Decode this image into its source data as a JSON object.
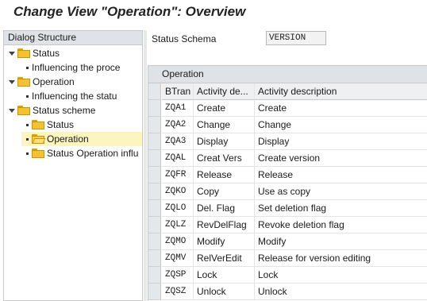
{
  "title": "Change View \"Operation\": Overview",
  "dialog_structure": {
    "header": "Dialog Structure",
    "items": [
      {
        "label": "Status",
        "level": 0,
        "type": "folder",
        "expanded": true,
        "selected": false
      },
      {
        "label": "Influencing the proce",
        "level": 1,
        "type": "item",
        "selected": false
      },
      {
        "label": "Operation",
        "level": 0,
        "type": "folder",
        "expanded": true,
        "selected": false
      },
      {
        "label": "Influencing the statu",
        "level": 1,
        "type": "item",
        "selected": false
      },
      {
        "label": "Status scheme",
        "level": 0,
        "type": "folder",
        "expanded": true,
        "selected": false
      },
      {
        "label": "Status",
        "level": 1,
        "type": "folder",
        "selected": false
      },
      {
        "label": "Operation",
        "level": 1,
        "type": "folder-open",
        "selected": true
      },
      {
        "label": "Status Operation influ",
        "level": 1,
        "type": "folder",
        "selected": false
      }
    ]
  },
  "status_schema": {
    "label": "Status Schema",
    "value": "VERSION"
  },
  "table": {
    "title": "Operation",
    "columns": [
      "BTran",
      "Activity de...",
      "Activity description"
    ],
    "rows": [
      [
        "ZQA1",
        "Create",
        "Create"
      ],
      [
        "ZQA2",
        "Change",
        "Change"
      ],
      [
        "ZQA3",
        "Display",
        "Display"
      ],
      [
        "ZQAL",
        "Creat Vers",
        "Create version"
      ],
      [
        "ZQFR",
        "Release",
        "Release"
      ],
      [
        "ZQKO",
        "Copy",
        "Use as copy"
      ],
      [
        "ZQLO",
        "Del. Flag",
        "Set deletion flag"
      ],
      [
        "ZQLZ",
        "RevDelFlag",
        "Revoke deletion flag"
      ],
      [
        "ZQMO",
        "Modify",
        "Modify"
      ],
      [
        "ZQMV",
        "RelVerEdit",
        "Release for version editing"
      ],
      [
        "ZQSP",
        "Lock",
        "Lock"
      ],
      [
        "ZQSZ",
        "Unlock",
        "Unlock"
      ]
    ]
  },
  "colors": {
    "selected_tree_bg": "#fdf5c0",
    "header_bg": "#dfe3e8",
    "folder": "#f2c230"
  }
}
